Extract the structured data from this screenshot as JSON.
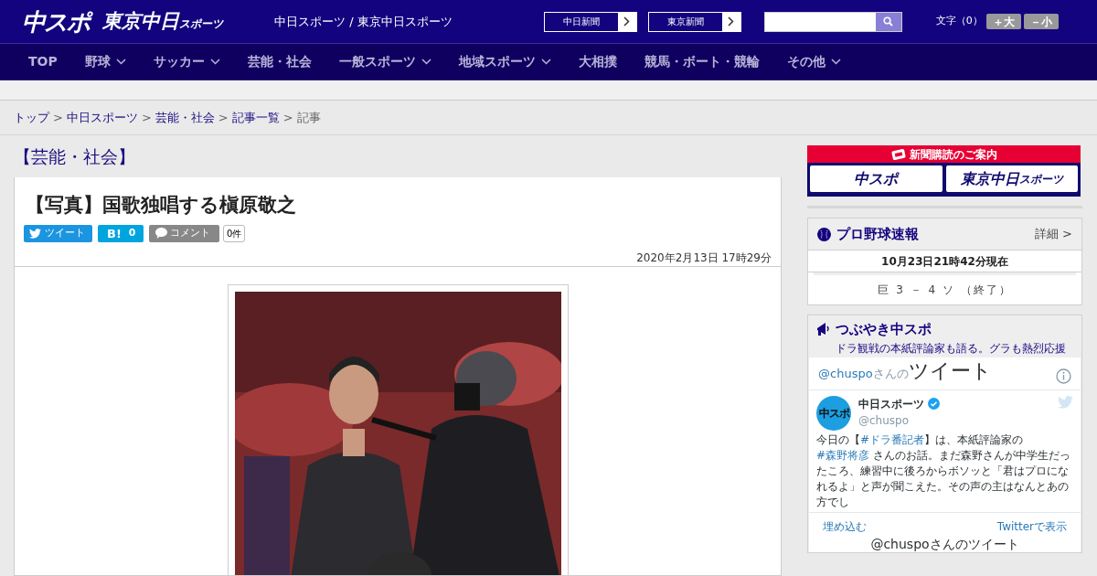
{
  "header": {
    "logo_main": "中スポ",
    "logo_tokyo": "東京中日",
    "logo_tokyo_small": "スポーツ",
    "site_title": "中日スポーツ / 東京中日スポーツ",
    "paper_links": [
      "中日新聞",
      "東京新聞"
    ],
    "font_size": {
      "label": "文字（0）",
      "buttons": [
        "＋大",
        "－小"
      ]
    }
  },
  "nav": [
    {
      "label": "TOP",
      "dropdown": false
    },
    {
      "label": "野球",
      "dropdown": true
    },
    {
      "label": "サッカー",
      "dropdown": true
    },
    {
      "label": "芸能・社会",
      "dropdown": false
    },
    {
      "label": "一般スポーツ",
      "dropdown": true
    },
    {
      "label": "地域スポーツ",
      "dropdown": true
    },
    {
      "label": "大相撲",
      "dropdown": false
    },
    {
      "label": "競馬・ボート・競輪",
      "dropdown": false
    },
    {
      "label": "その他",
      "dropdown": true
    }
  ],
  "breadcrumb": [
    {
      "label": "トップ",
      "link": true
    },
    {
      "separator_before": ">",
      "label": "中日スポーツ",
      "link": true
    },
    {
      "separator_before": ">",
      "label": "芸能・社会",
      "link": true
    },
    {
      "separator_before": ">",
      "label": "記事一覧",
      "link": true
    },
    {
      "separator_before": ">",
      "label": "記事",
      "link": false
    }
  ],
  "section_title": "【芸能・社会】",
  "article": {
    "title": "【写真】国歌独唱する槇原敬之",
    "share": {
      "tweet": "ツイート",
      "hatena_mark": "B!",
      "hatena_count": "0",
      "comment": "コメント",
      "comment_count": "0件"
    },
    "date": "2020年2月13日 17時29分"
  },
  "sidebar": {
    "subscribe": {
      "title": "新聞購読のご案内",
      "logos": [
        "中スポ",
        "東京中日"
      ],
      "logo_small": "スポーツ"
    },
    "baseball": {
      "title": "プロ野球速報",
      "detail": "詳細 >",
      "updated": "10月23日21時42分現在",
      "score": "巨 3 － 4 ソ （終了）"
    },
    "tweets": {
      "title": "つぶやき中スポ",
      "subtitle": "ドラ観戦の本紙評論家も語る。グラも熱烈応援",
      "widget_handle": "@chuspo",
      "widget_handle_suffix": "さんの",
      "widget_title": "ツイート",
      "account_name": "中日スポーツ",
      "verified": true,
      "account_handle": "@chuspo",
      "avatar": "中スポ",
      "tweet": [
        {
          "kind": "text",
          "text": "今日の【"
        },
        {
          "kind": "link",
          "text": "#ドラ番記者"
        },
        {
          "kind": "text",
          "text": "】は、本紙評論家の "
        },
        {
          "kind": "link",
          "text": "#森野将彦"
        },
        {
          "kind": "text",
          "text": " さんのお話。まだ森野さんが中学生だったころ、練習中に後ろからボソッと「君はプロになれるよ」と声が聞こえた。その声の主はなんとあの方でし"
        }
      ],
      "embed": "埋め込む",
      "view_on_twitter": "Twitterで表示",
      "footer_title": "@chuspoさんのツイート"
    }
  }
}
